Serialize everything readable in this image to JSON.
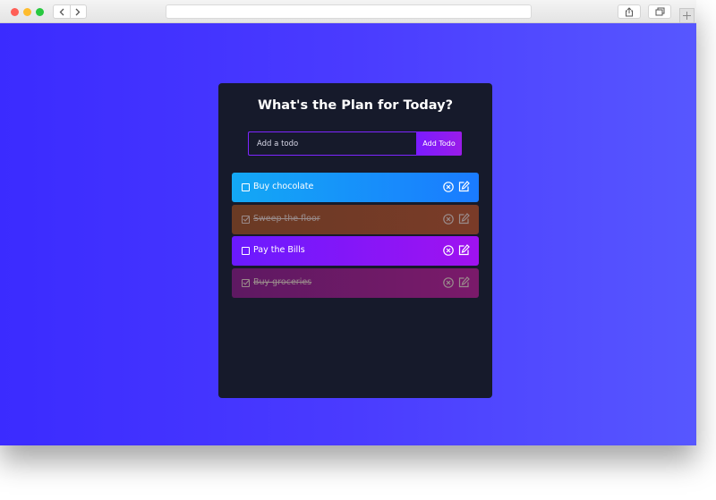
{
  "app": {
    "title": "What's the Plan for Today?",
    "input_placeholder": "Add a todo",
    "add_button_label": "Add Todo"
  },
  "todos": [
    {
      "text": "Buy chocolate",
      "completed": false,
      "color": "#13a8f5"
    },
    {
      "text": "Sweep the floor",
      "completed": true,
      "color": "#6a3a24"
    },
    {
      "text": "Pay the Bills",
      "completed": false,
      "color": "#6a1aff"
    },
    {
      "text": "Buy groceries",
      "completed": true,
      "color": "#5e1962"
    }
  ],
  "colors": {
    "background_gradient": [
      "#3b2bff",
      "#5757ff"
    ],
    "card_background": "#161a2b",
    "accent": "#7d25ff"
  }
}
